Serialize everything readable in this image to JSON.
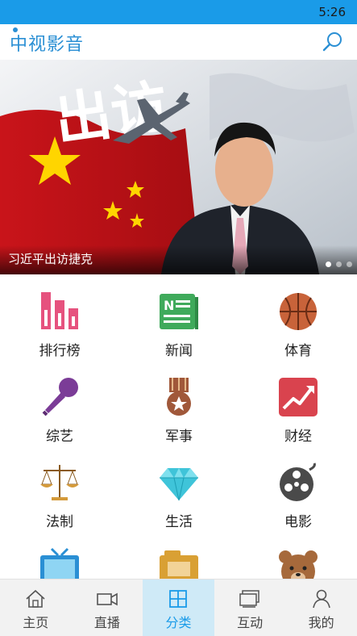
{
  "status_bar": {
    "time": "5:26"
  },
  "header": {
    "logo_text": "中视影音",
    "search_icon": "search-icon"
  },
  "banner": {
    "caption": "习近平出访捷克",
    "overlay_text": "出访",
    "slide_count": 3,
    "active_slide": 1
  },
  "categories": [
    {
      "label": "排行榜",
      "icon": "ranking-bars-icon"
    },
    {
      "label": "新闻",
      "icon": "newspaper-icon"
    },
    {
      "label": "体育",
      "icon": "basketball-icon"
    },
    {
      "label": "综艺",
      "icon": "microphone-icon"
    },
    {
      "label": "军事",
      "icon": "military-medal-icon"
    },
    {
      "label": "财经",
      "icon": "finance-chart-icon"
    },
    {
      "label": "法制",
      "icon": "justice-scale-icon"
    },
    {
      "label": "生活",
      "icon": "diamond-icon"
    },
    {
      "label": "电影",
      "icon": "film-reel-icon"
    },
    {
      "label": "",
      "icon": "tv-icon"
    },
    {
      "label": "",
      "icon": "folder-icon"
    },
    {
      "label": "",
      "icon": "bear-icon"
    }
  ],
  "tabbar": {
    "tabs": [
      {
        "label": "主页",
        "icon": "home-icon"
      },
      {
        "label": "直播",
        "icon": "video-camera-icon"
      },
      {
        "label": "分类",
        "icon": "grid-icon"
      },
      {
        "label": "互动",
        "icon": "interaction-icon"
      },
      {
        "label": "我的",
        "icon": "user-icon"
      }
    ],
    "active": "分类"
  },
  "colors": {
    "status_bar": "#1a9be8",
    "accent": "#1a9be8",
    "active_tab_bg": "#cfeaf7",
    "logo": "#2a8fd4"
  }
}
